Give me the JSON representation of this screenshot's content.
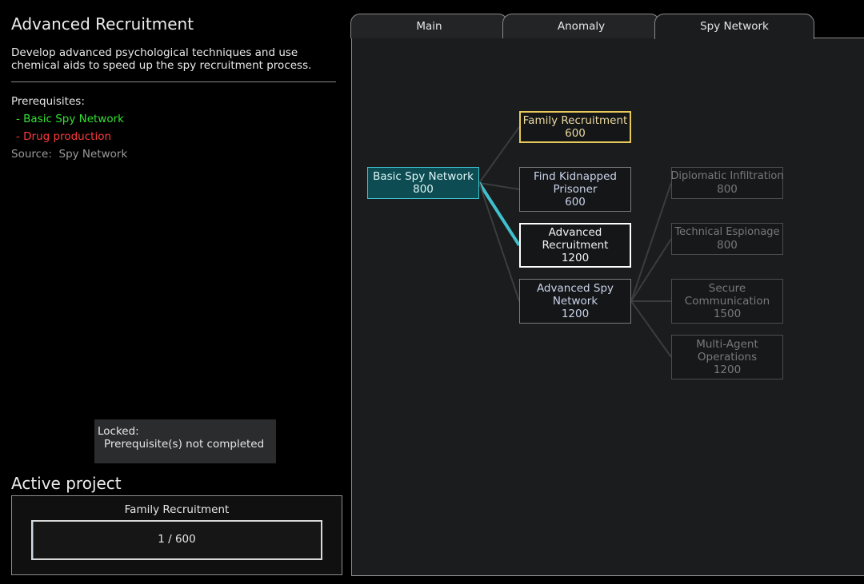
{
  "tech": {
    "title": "Advanced Recruitment",
    "description": "Develop advanced psychological techniques and use chemical aids to speed up the spy recruitment process.",
    "prerequisites_label": "Prerequisites:",
    "prerequisites": [
      {
        "label": "- Basic Spy Network",
        "status": "met",
        "color": "#33e033"
      },
      {
        "label": "- Drug production",
        "status": "unmet",
        "color": "#ff3a3a"
      }
    ],
    "source": "Source:  Spy Network"
  },
  "lock_notice": {
    "title": "Locked:",
    "reason": "Prerequisite(s) not completed"
  },
  "active_project": {
    "heading": "Active project",
    "name": "Family Recruitment",
    "progress_text": "1 / 600",
    "progress": 0.0017
  },
  "tabs": [
    {
      "label": "Main",
      "selected": false
    },
    {
      "label": "Anomaly",
      "selected": false
    },
    {
      "label": "Spy Network",
      "selected": true
    }
  ],
  "tree": {
    "nodes": [
      {
        "id": "basic-spy-network",
        "name": "Basic Spy Network",
        "cost": "800",
        "state": "researched"
      },
      {
        "id": "family-recruitment",
        "name": "Family Recruitment",
        "cost": "600",
        "state": "active"
      },
      {
        "id": "find-kidnapped-prisoner",
        "name": "Find Kidnapped Prisoner",
        "cost": "600",
        "state": "available"
      },
      {
        "id": "advanced-recruitment",
        "name": "Advanced Recruitment",
        "cost": "1200",
        "state": "selected"
      },
      {
        "id": "advanced-spy-network",
        "name": "Advanced Spy Network",
        "cost": "1200",
        "state": "available"
      },
      {
        "id": "diplomatic-infiltration",
        "name": "Diplomatic Infiltration",
        "cost": "800",
        "state": "locked"
      },
      {
        "id": "technical-espionage",
        "name": "Technical Espionage",
        "cost": "800",
        "state": "locked"
      },
      {
        "id": "secure-communication",
        "name": "Secure Communication",
        "cost": "1500",
        "state": "locked"
      },
      {
        "id": "multi-agent-operations",
        "name": "Multi-Agent Operations",
        "cost": "1200",
        "state": "locked"
      }
    ],
    "links": [
      {
        "from": "basic-spy-network",
        "to": "family-recruitment",
        "highlight": false
      },
      {
        "from": "basic-spy-network",
        "to": "find-kidnapped-prisoner",
        "highlight": false
      },
      {
        "from": "basic-spy-network",
        "to": "advanced-recruitment",
        "highlight": true
      },
      {
        "from": "basic-spy-network",
        "to": "advanced-spy-network",
        "highlight": false
      },
      {
        "from": "advanced-spy-network",
        "to": "diplomatic-infiltration",
        "highlight": false
      },
      {
        "from": "advanced-spy-network",
        "to": "technical-espionage",
        "highlight": false
      },
      {
        "from": "advanced-spy-network",
        "to": "secure-communication",
        "highlight": false
      },
      {
        "from": "advanced-spy-network",
        "to": "multi-agent-operations",
        "highlight": false
      }
    ],
    "colors": {
      "link": "#3a3c3e",
      "link_highlight": "#3fc0cc"
    }
  }
}
